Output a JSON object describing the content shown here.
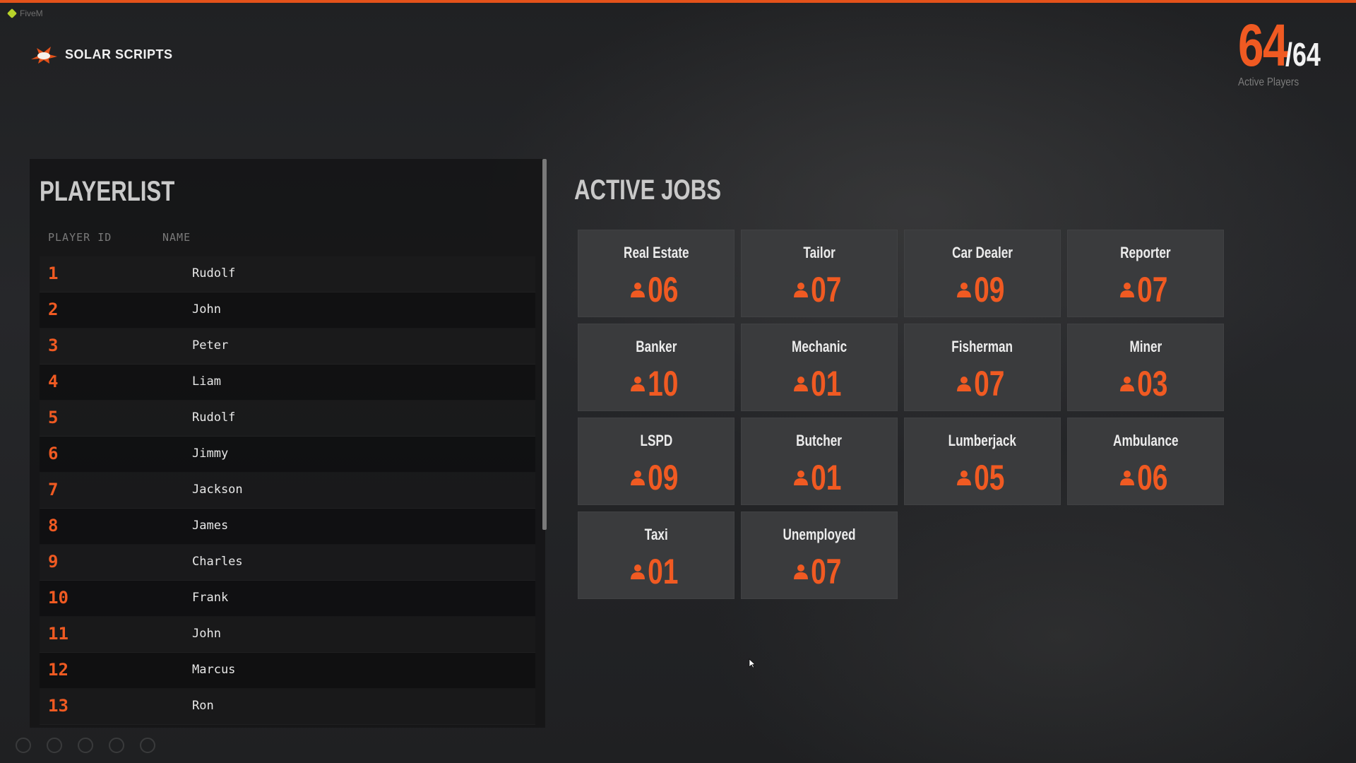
{
  "window": {
    "app_name": "FiveM"
  },
  "brand": {
    "name": "SOLAR SCRIPTS",
    "accent_color": "#f05a22"
  },
  "players_counter": {
    "current": "64",
    "max": "/64",
    "label": "Active Players"
  },
  "playerlist": {
    "title": "PLAYERLIST",
    "columns": [
      "PLAYER ID",
      "NAME"
    ],
    "rows": [
      {
        "id": "1",
        "name": "Rudolf"
      },
      {
        "id": "2",
        "name": "John"
      },
      {
        "id": "3",
        "name": "Peter"
      },
      {
        "id": "4",
        "name": "Liam"
      },
      {
        "id": "5",
        "name": "Rudolf"
      },
      {
        "id": "6",
        "name": "Jimmy"
      },
      {
        "id": "7",
        "name": "Jackson"
      },
      {
        "id": "8",
        "name": "James"
      },
      {
        "id": "9",
        "name": "Charles"
      },
      {
        "id": "10",
        "name": "Frank"
      },
      {
        "id": "11",
        "name": "John"
      },
      {
        "id": "12",
        "name": "Marcus"
      },
      {
        "id": "13",
        "name": "Ron"
      }
    ]
  },
  "jobs": {
    "title": "ACTIVE JOBS",
    "icon": "person-icon",
    "items": [
      {
        "name": "Real Estate",
        "count": "06"
      },
      {
        "name": "Tailor",
        "count": "07"
      },
      {
        "name": "Car Dealer",
        "count": "09"
      },
      {
        "name": "Reporter",
        "count": "07"
      },
      {
        "name": "Banker",
        "count": "10"
      },
      {
        "name": "Mechanic",
        "count": "01"
      },
      {
        "name": "Fisherman",
        "count": "07"
      },
      {
        "name": "Miner",
        "count": "03"
      },
      {
        "name": "LSPD",
        "count": "09"
      },
      {
        "name": "Butcher",
        "count": "01"
      },
      {
        "name": "Lumberjack",
        "count": "05"
      },
      {
        "name": "Ambulance",
        "count": "06"
      },
      {
        "name": "Taxi",
        "count": "01"
      },
      {
        "name": "Unemployed",
        "count": "07"
      }
    ]
  }
}
